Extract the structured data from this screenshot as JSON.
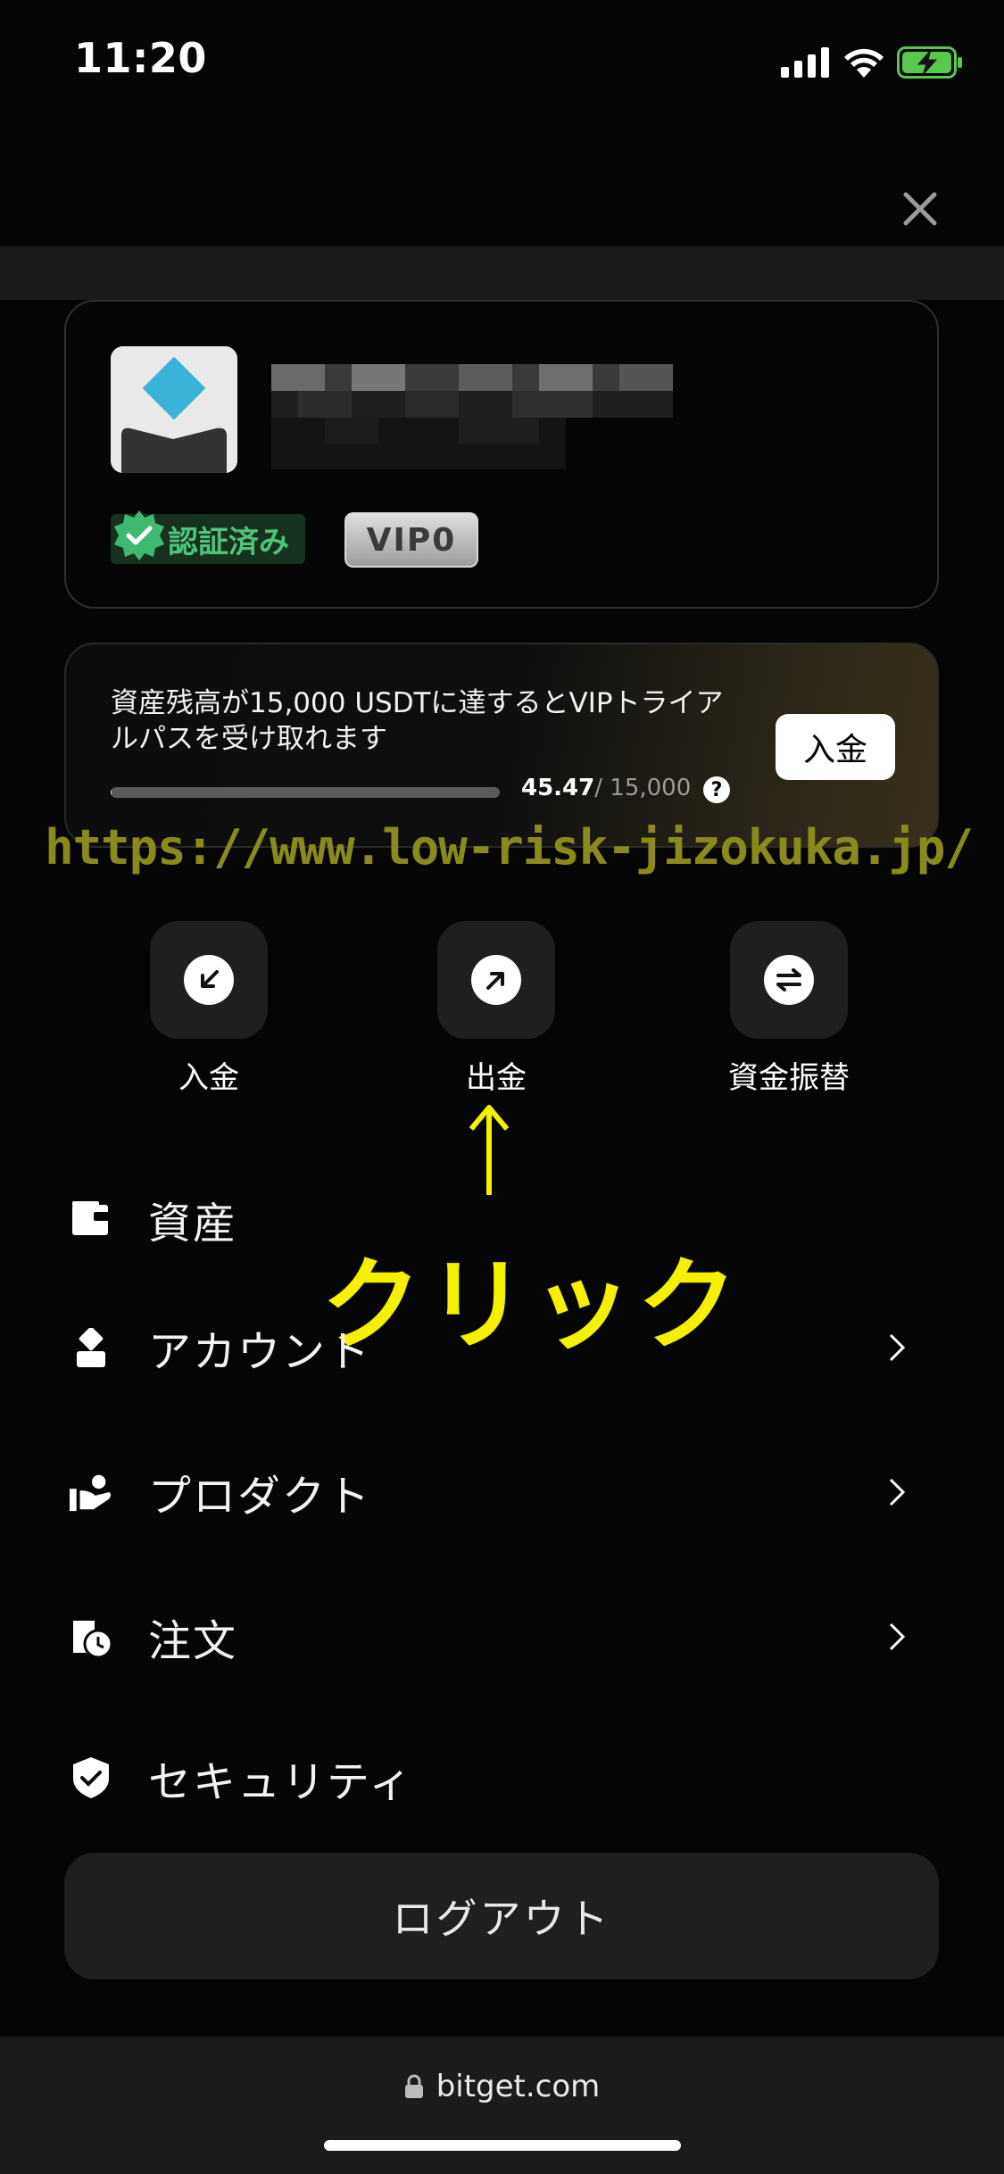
{
  "status_bar": {
    "time": "11:20"
  },
  "profile": {
    "verified_label": "認証済み",
    "vip_label": "VIP0"
  },
  "promo": {
    "message": "資産残高が15,000 USDTに達するとVIPトライアルパスを受け取れます",
    "progress_current": "45.47",
    "progress_target": "/ 15,000",
    "progress_fraction": 0.003,
    "help": "?",
    "deposit_button": "入金"
  },
  "watermark": "https://www.low-risk-jizokuka.jp/",
  "quick_actions": [
    {
      "label": "入金",
      "icon": "deposit-arrow-icon"
    },
    {
      "label": "出金",
      "icon": "withdraw-arrow-icon"
    },
    {
      "label": "資金振替",
      "icon": "transfer-icon"
    }
  ],
  "annotation": {
    "label": "クリック",
    "arrow": "↑"
  },
  "menu": [
    {
      "label": "資産",
      "icon": "wallet-icon",
      "has_chevron": false
    },
    {
      "label": "アカウント",
      "icon": "account-icon",
      "has_chevron": true
    },
    {
      "label": "プロダクト",
      "icon": "product-icon",
      "has_chevron": true
    },
    {
      "label": "注文",
      "icon": "order-icon",
      "has_chevron": true
    },
    {
      "label": "セキュリティ",
      "icon": "shield-icon",
      "has_chevron": false
    }
  ],
  "logout_button": "ログアウト",
  "browser": {
    "url": "bitget.com"
  },
  "colors": {
    "accent_yellow": "#f4f000",
    "verified_green": "#4ec37a",
    "watermark": "#8a8a1c"
  }
}
